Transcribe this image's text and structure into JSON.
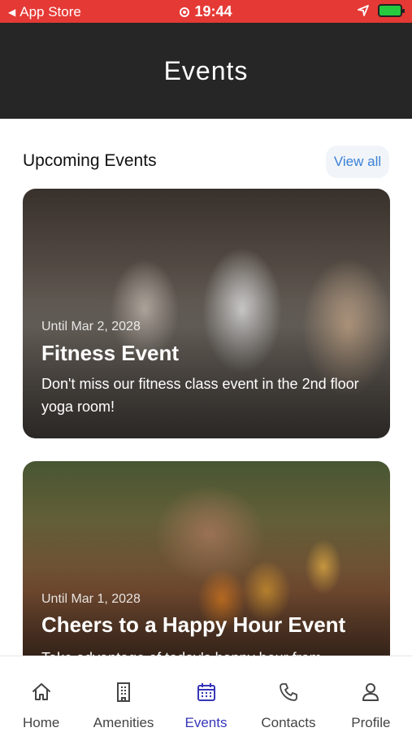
{
  "status_bar": {
    "back_app": "App Store",
    "time": "19:44"
  },
  "header": {
    "title": "Events"
  },
  "section": {
    "title": "Upcoming Events",
    "view_all_label": "View all"
  },
  "events": [
    {
      "date": "Until Mar 2, 2028",
      "title": "Fitness Event",
      "description": "Don't miss our fitness class event in the 2nd floor yoga room!"
    },
    {
      "date": "Until Mar 1, 2028",
      "title": "Cheers to a Happy Hour Event",
      "description": "Take advantage of today's happy hour from"
    }
  ],
  "bottom_nav": {
    "items": [
      {
        "label": "Home",
        "icon": "home-icon"
      },
      {
        "label": "Amenities",
        "icon": "building-icon"
      },
      {
        "label": "Events",
        "icon": "calendar-icon"
      },
      {
        "label": "Contacts",
        "icon": "phone-icon"
      },
      {
        "label": "Profile",
        "icon": "user-icon"
      }
    ],
    "active": "Events"
  },
  "colors": {
    "status_bar": "#e53935",
    "header_bg": "#262626",
    "accent": "#3636b8",
    "link": "#3b82d6"
  }
}
